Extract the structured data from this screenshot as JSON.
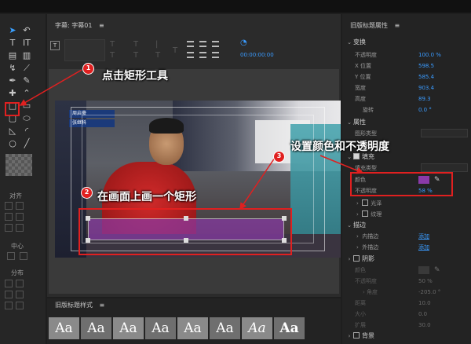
{
  "topbar": {
    "bg": "#111111"
  },
  "tools": [
    "select-icon",
    "rotate-icon",
    "text-icon",
    "vertical-text-icon",
    "area-text-icon",
    "vertical-area-text-icon",
    "path-text-icon",
    "vertical-path-text-icon",
    "pen-icon",
    "delete-anchor-icon",
    "add-anchor-icon",
    "convert-anchor-icon",
    "rectangle-icon",
    "clipped-corner-rect-icon",
    "rounded-rect-icon",
    "rounded-corner-rect-icon",
    "wedge-icon",
    "arc-icon",
    "ellipse-icon",
    "line-icon"
  ],
  "align_panel": {
    "align": "对齐",
    "center": "中心",
    "distribute": "分布"
  },
  "editor": {
    "title": "字幕: 字幕01",
    "timecode": "00:00:00:00",
    "scoreboard": [
      "周启豪",
      "张继科"
    ]
  },
  "style_panel": {
    "title": "旧版标题样式",
    "swatch": "Aa"
  },
  "props": {
    "title": "旧版标题属性",
    "transform": {
      "header": "变换",
      "rows": [
        {
          "label": "不透明度",
          "value": "100.0 %"
        },
        {
          "label": "X 位置",
          "value": "598.5"
        },
        {
          "label": "Y 位置",
          "value": "585.4"
        },
        {
          "label": "宽度",
          "value": "903.4"
        },
        {
          "label": "高度",
          "value": "89.3"
        },
        {
          "label": "旋转",
          "value": "0.0 °"
        }
      ]
    },
    "attributes": {
      "header": "属性",
      "shape_type": "图形类型"
    },
    "fill": {
      "header": "填充",
      "fill_type": "填充类型",
      "color_label": "颜色",
      "color_value": "#8a3aa8",
      "opacity_label": "不透明度",
      "opacity_value": "58 %",
      "sheen": "光泽",
      "texture": "纹理"
    },
    "stroke": {
      "header": "描边",
      "inner": "内描边",
      "outer": "外描边",
      "add": "添加"
    },
    "shadow": {
      "header": "阴影",
      "color": "颜色",
      "opacity": "不透明度",
      "opacity_value": "50 %",
      "angle": "角度",
      "angle_value": "-205.0 °",
      "distance": "距离",
      "distance_value": "10.0",
      "size": "大小",
      "size_value": "0.0",
      "spread": "扩展",
      "spread_value": "30.0"
    },
    "background": {
      "header": "背景"
    }
  },
  "annotations": {
    "n1": "1",
    "t1": "点击矩形工具",
    "n2": "2",
    "t2": "在画面上画一个矩形",
    "n3": "3",
    "t3": "设置颜色和不透明度"
  },
  "colors": {
    "accent": "#3a9bff",
    "annotation_red": "#e02020",
    "rect_fill": "#8a3aa8"
  }
}
